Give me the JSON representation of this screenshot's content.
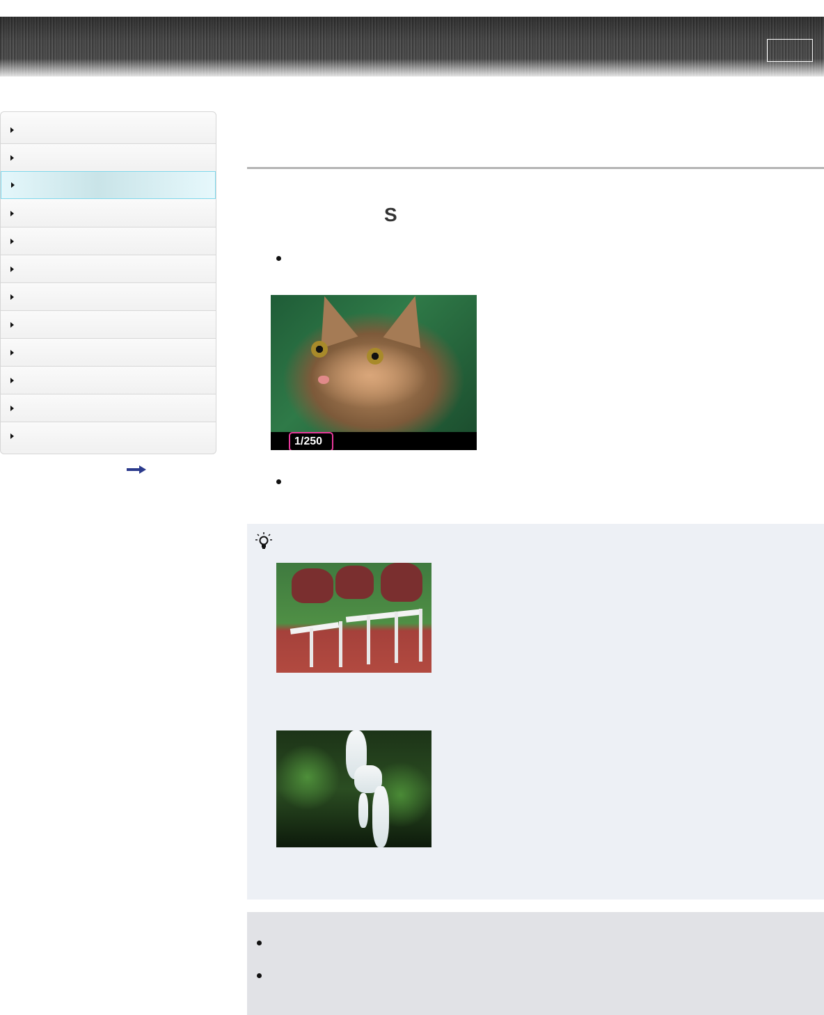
{
  "header": {
    "button_label": ""
  },
  "sidebar": {
    "items": [
      {
        "label": "",
        "active": false
      },
      {
        "label": "",
        "active": false
      },
      {
        "label": "",
        "active": true
      },
      {
        "label": "",
        "active": false
      },
      {
        "label": "",
        "active": false
      },
      {
        "label": "",
        "active": false
      },
      {
        "label": "",
        "active": false
      },
      {
        "label": "",
        "active": false
      },
      {
        "label": "",
        "active": false
      },
      {
        "label": "",
        "active": false
      },
      {
        "label": "",
        "active": false
      },
      {
        "label": "",
        "active": false
      }
    ],
    "more_link_icon": "right-arrow-icon"
  },
  "main": {
    "title": "",
    "mode_symbol": "S",
    "shutter_speed_readout": "1/250",
    "images": [
      "cat-photo",
      "hurdle-photo",
      "waterfall-photo"
    ],
    "hint_icon": "lightbulb-icon"
  },
  "colors": {
    "active_nav_border": "#7fd8ec",
    "shutter_badge_border": "#e8399b",
    "hint_background": "#edf0f5",
    "note_background": "#e1e2e6",
    "title_rule": "#b4b4b4"
  }
}
